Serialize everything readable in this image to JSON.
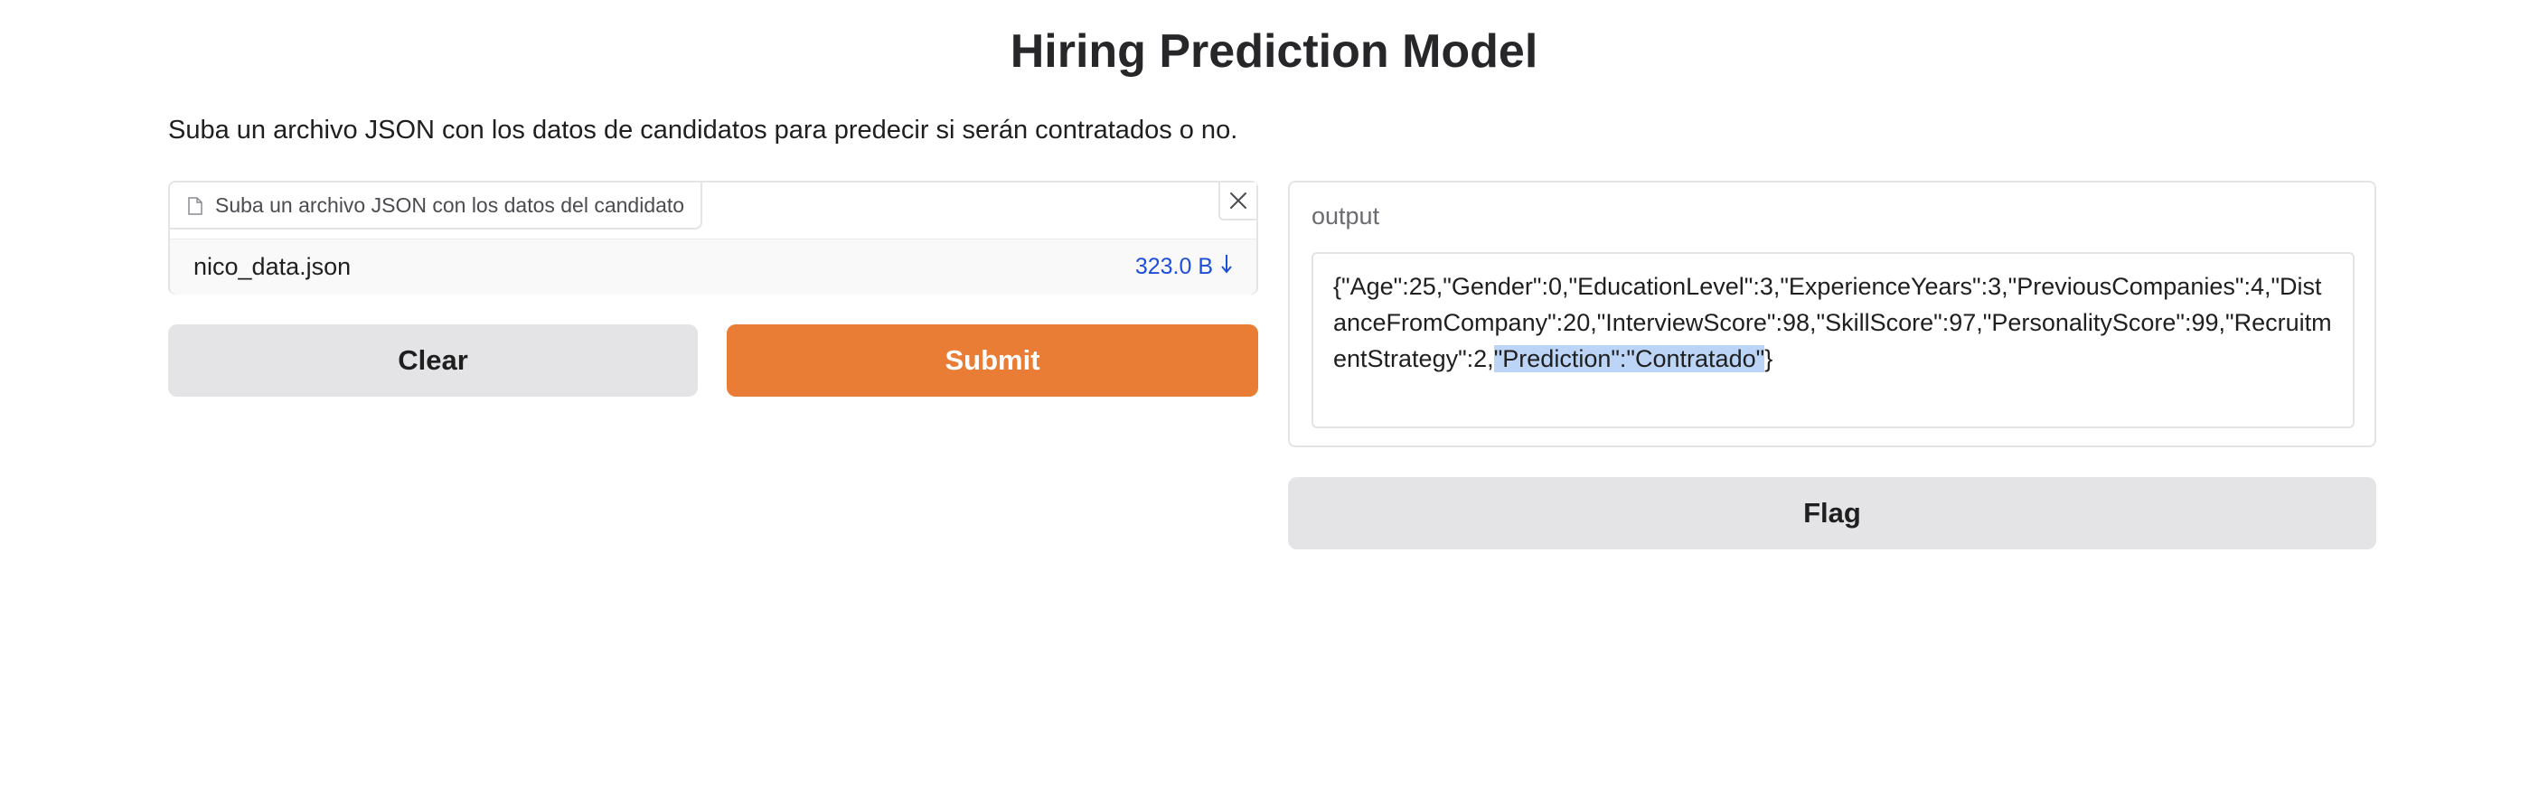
{
  "header": {
    "title": "Hiring Prediction Model",
    "description": "Suba un archivo JSON con los datos de candidatos para predecir si serán contratados o no."
  },
  "upload": {
    "label": "Suba un archivo JSON con los datos del candidato",
    "file_name": "nico_data.json",
    "file_size": "323.0 B",
    "file_icon": "file-icon",
    "clear_icon": "close-icon",
    "download_icon": "download-arrow-icon"
  },
  "buttons": {
    "clear": "Clear",
    "submit": "Submit",
    "flag": "Flag"
  },
  "output": {
    "label": "output",
    "text_before_selection": "{\"Age\":25,\"Gender\":0,\"EducationLevel\":3,\"ExperienceYears\":3,\"PreviousCompanies\":4,\"DistanceFromCompany\":20,\"InterviewScore\":98,\"SkillScore\":97,\"PersonalityScore\":99,\"RecruitmentStrategy\":2,",
    "selected_text": "\"Prediction\":\"Contratado\"",
    "text_after_selection": "}"
  },
  "colors": {
    "primary": "#ea7d35",
    "secondary": "#e4e4e7",
    "link": "#1d4ed8",
    "selection": "#bcd4f6"
  }
}
